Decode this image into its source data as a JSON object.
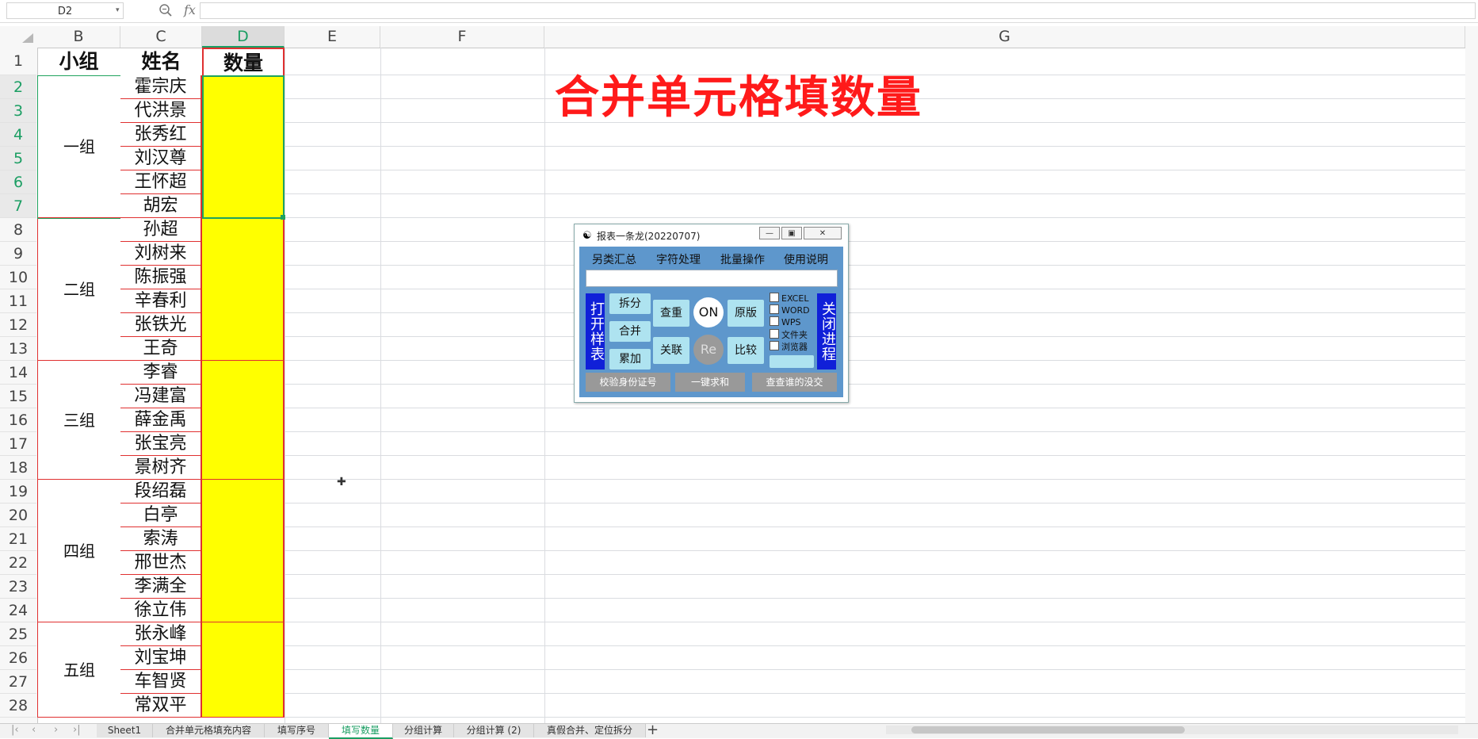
{
  "formula_bar": {
    "name_box": "D2",
    "fx": "fx",
    "formula": ""
  },
  "columns": [
    "B",
    "C",
    "D",
    "E",
    "F",
    "G"
  ],
  "rows": [
    "1",
    "2",
    "3",
    "4",
    "5",
    "6",
    "7",
    "8",
    "9",
    "10",
    "11",
    "12",
    "13",
    "14",
    "15",
    "16",
    "17",
    "18",
    "19",
    "20",
    "21",
    "22",
    "23",
    "24",
    "25",
    "26",
    "27",
    "28"
  ],
  "headers": {
    "group": "小组",
    "name": "姓名",
    "qty": "数量"
  },
  "groups": [
    "一组",
    "二组",
    "三组",
    "四组",
    "五组"
  ],
  "names": [
    "霍宗庆",
    "代洪景",
    "张秀红",
    "刘汉尊",
    "王怀超",
    "胡宏",
    "孙超",
    "刘树来",
    "陈振强",
    "辛春利",
    "张铁光",
    "王奇",
    "李睿",
    "冯建富",
    "薛金禹",
    "张宝亮",
    "景树齐",
    "段绍磊",
    "白亭",
    "索涛",
    "邢世杰",
    "李满全",
    "徐立伟",
    "张永峰",
    "刘宝坤",
    "车智贤",
    "常双平"
  ],
  "big_title": "合并单元格填数量",
  "tool": {
    "title": "报表一条龙(20220707)",
    "menu": [
      "另类汇总",
      "字符处理",
      "批量操作",
      "使用说明"
    ],
    "open_label": "打开样表",
    "close_label": "关闭进程",
    "split": "拆分",
    "merge": "合并",
    "accumulate": "累加",
    "dedupe": "查重",
    "associate": "关联",
    "on": "ON",
    "re": "Re",
    "original": "原版",
    "compare": "比较",
    "checks": [
      "EXCEL",
      "WORD",
      "WPS",
      "文件夹",
      "浏览器"
    ],
    "bottom": [
      "校验身份证号",
      "一键求和",
      "查查谁的没交"
    ]
  },
  "sheet_tabs": [
    "Sheet1",
    "合并单元格填充内容",
    "填写序号",
    "填写数量",
    "分组计算",
    "分组计算 (2)",
    "真假合并、定位拆分"
  ],
  "active_tab": "填写数量",
  "colors": {
    "accent": "#1b9e63",
    "qty_fill": "#ffff00",
    "border_red": "#e03030",
    "title_red": "#ff1a1a",
    "tool_blue": "#5e97cc"
  }
}
